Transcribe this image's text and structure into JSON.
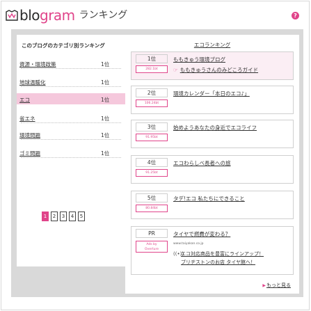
{
  "header": {
    "logo_blo": "blo",
    "logo_gram": "gram",
    "ranking": "ランキング",
    "help": "?"
  },
  "left": {
    "heading": "このブログのカテゴリ別ランキング",
    "categories": [
      {
        "name": "資源・環境政策",
        "rank": "1位"
      },
      {
        "name": "地球温暖化",
        "rank": "1位"
      },
      {
        "name": "エコ",
        "rank": "1位"
      },
      {
        "name": "省エネ",
        "rank": "1位"
      },
      {
        "name": "環境問題",
        "rank": "1位"
      },
      {
        "name": "ゴミ問題",
        "rank": "1位"
      }
    ],
    "pages": [
      "1",
      "2",
      "3",
      "4",
      "5"
    ]
  },
  "right": {
    "heading": "エコランキング",
    "entries": [
      {
        "rank": "1位",
        "tag": "282.1bt",
        "title": "ももきゅう環境ブログ",
        "sub": "ももきゅうさんのみどころガイド"
      },
      {
        "rank": "2位",
        "tag": "106.24bt",
        "title": "環境カレンダー「本日のエコ♪」",
        "sub": ""
      },
      {
        "rank": "3位",
        "tag": "91.95bt",
        "title": "始めようあなたの身近でエコライフ",
        "sub": ""
      },
      {
        "rank": "4位",
        "tag": "91.25bt",
        "title": "エコわらしべ長者への旅",
        "sub": ""
      },
      {
        "rank": "5位",
        "tag": "80.84bt",
        "title": "タデ!エコ 私たちにできること",
        "sub": ""
      }
    ],
    "pr": {
      "rank": "PR",
      "tag_line1": "Ads by",
      "tag_line2": "Overture",
      "title": "タイヤで燃費が変わる？",
      "url": "www.taiyakan.co.jp",
      "line1": "エコ対応商品を豊富にラインアップ！",
      "line2": "ブリヂストンのお店 タイヤ館へ！"
    },
    "more": "もっと見る"
  },
  "colors": {
    "accent": "#e0448a",
    "panel_grey": "#d9d9d9",
    "active_row": "#f5c8dc"
  }
}
